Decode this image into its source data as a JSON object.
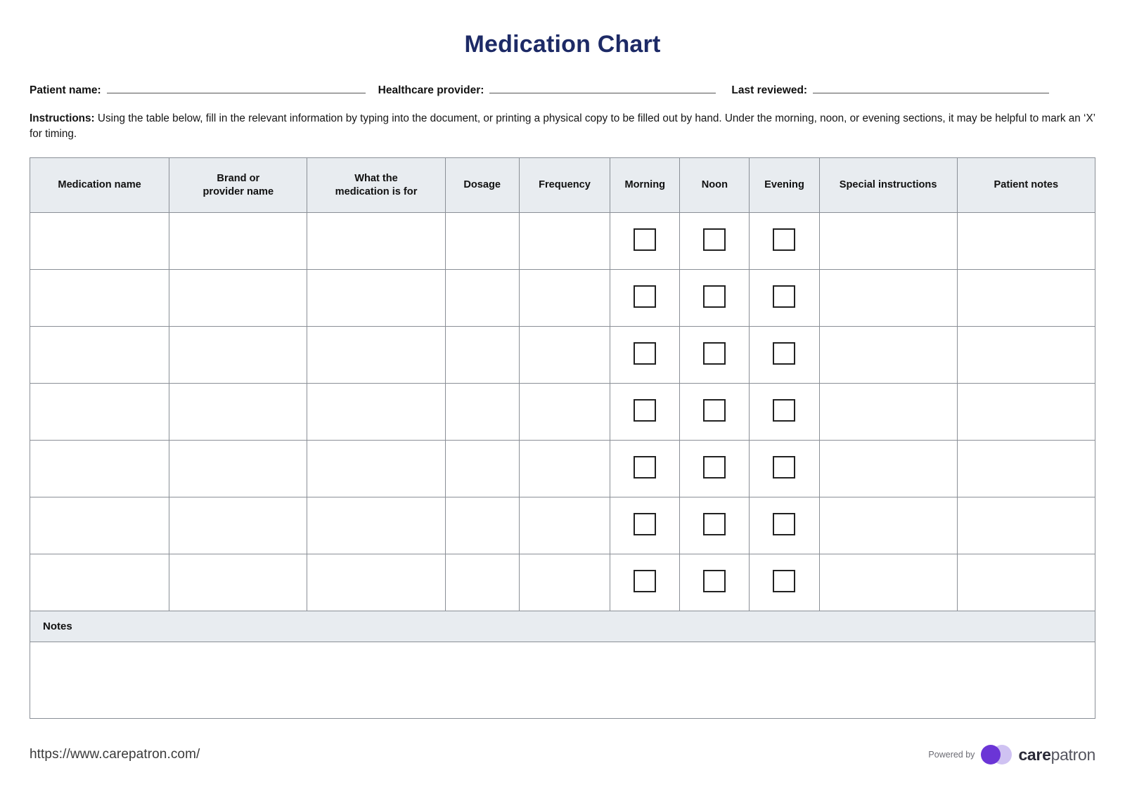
{
  "document": {
    "title": "Medication Chart"
  },
  "fields": [
    {
      "label": "Patient name:",
      "value": ""
    },
    {
      "label": "Healthcare provider:",
      "value": ""
    },
    {
      "label": "Last reviewed:",
      "value": ""
    }
  ],
  "instructions": {
    "label": "Instructions:",
    "text": " Using the table below, fill in the relevant information by typing into the document, or printing a physical copy to be filled out by hand. Under the morning, noon, or evening sections, it may be helpful to mark an ‘X’ for timing."
  },
  "table": {
    "headers": [
      "Medication name",
      "Brand or\nprovider name",
      "What the\nmedication is for",
      "Dosage",
      "Frequency",
      "Morning",
      "Noon",
      "Evening",
      "Special instructions",
      "Patient notes"
    ],
    "row_count": 7,
    "checkbox_columns": [
      "Morning",
      "Noon",
      "Evening"
    ]
  },
  "notes": {
    "label": "Notes",
    "value": ""
  },
  "footer": {
    "url": "https://www.carepatron.com/",
    "powered_by": "Powered by",
    "brand_strong": "care",
    "brand_light": "patron"
  },
  "colors": {
    "title": "#1d2a66",
    "header_bg": "#e8ecf0",
    "border": "#8a8f96",
    "brand_primary": "#6b35d6",
    "brand_secondary": "#cfc2f2"
  }
}
